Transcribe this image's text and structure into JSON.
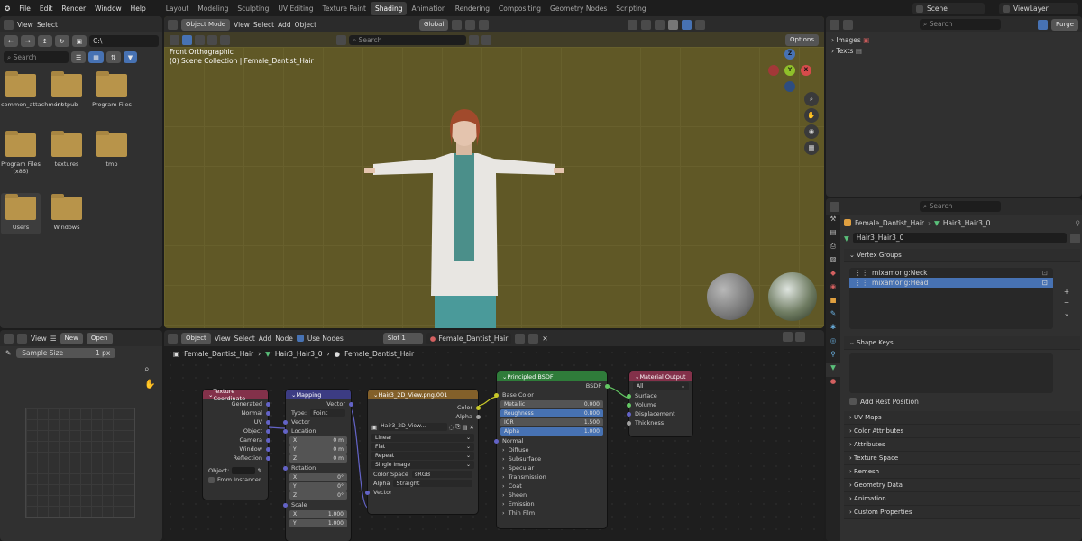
{
  "menubar": {
    "items": [
      "File",
      "Edit",
      "Render",
      "Window",
      "Help"
    ]
  },
  "workspaces": {
    "tabs": [
      "Layout",
      "Modeling",
      "Sculpting",
      "UV Editing",
      "Texture Paint",
      "Shading",
      "Animation",
      "Rendering",
      "Compositing",
      "Geometry Nodes",
      "Scripting"
    ],
    "active": "Shading"
  },
  "scene": {
    "name": "Scene",
    "view_layer": "ViewLayer"
  },
  "file_browser": {
    "menu": [
      "View",
      "Select"
    ],
    "path": "C:\\",
    "search_placeholder": "Search",
    "folders": [
      {
        "name": "common_attachment"
      },
      {
        "name": "inetpub"
      },
      {
        "name": "Program Files"
      },
      {
        "name": "Program Files (x86)"
      },
      {
        "name": "textures"
      },
      {
        "name": "tmp"
      },
      {
        "name": "Users"
      },
      {
        "name": "Windows"
      }
    ]
  },
  "viewport": {
    "mode": "Object Mode",
    "menus": [
      "View",
      "Select",
      "Add",
      "Object"
    ],
    "transform": "Global",
    "search_placeholder": "Search",
    "options_label": "Options",
    "view_name": "Front Orthographic",
    "collection": "(0) Scene Collection | Female_Dantist_Hair"
  },
  "outliner": {
    "search_placeholder": "Search",
    "purge_label": "Purge",
    "items": [
      "Images",
      "Texts"
    ]
  },
  "image_editor": {
    "view_label": "View",
    "new_label": "New",
    "open_label": "Open",
    "sample_size_label": "Sample Size",
    "sample_size_value": "1 px"
  },
  "node_editor": {
    "object_label": "Object",
    "menus": [
      "View",
      "Select",
      "Add",
      "Node"
    ],
    "use_nodes_label": "Use Nodes",
    "slot_label": "Slot 1",
    "material": "Female_Dantist_Hair",
    "breadcrumb": [
      "Female_Dantist_Hair",
      "Hair3_Hair3_0",
      "Female_Dantist_Hair"
    ]
  },
  "nodes": {
    "texcoord": {
      "title": "Texture Coordinate",
      "outputs": [
        "Generated",
        "Normal",
        "UV",
        "Object",
        "Camera",
        "Window",
        "Reflection"
      ],
      "object_label": "Object:",
      "from_instancer": "From Instancer"
    },
    "mapping": {
      "title": "Mapping",
      "output": "Vector",
      "type_label": "Type:",
      "type_value": "Point",
      "vector_label": "Vector",
      "location_label": "Location",
      "rotation_label": "Rotation",
      "scale_label": "Scale",
      "location": [
        {
          "axis": "X",
          "value": "0 m"
        },
        {
          "axis": "Y",
          "value": "0 m"
        },
        {
          "axis": "Z",
          "value": "0 m"
        }
      ],
      "rotation": [
        {
          "axis": "X",
          "value": "0°"
        },
        {
          "axis": "Y",
          "value": "0°"
        },
        {
          "axis": "Z",
          "value": "0°"
        }
      ],
      "scale": [
        {
          "axis": "X",
          "value": "1.000"
        },
        {
          "axis": "Y",
          "value": "1.000"
        }
      ]
    },
    "image": {
      "title": "Hair3_2D_View.png.001",
      "out_color": "Color",
      "out_alpha": "Alpha",
      "image_name": "Hair3_2D_View...",
      "interp": "Linear",
      "proj": "Flat",
      "ext": "Repeat",
      "source": "Single Image",
      "cs_label": "Color Space",
      "cs_value": "sRGB",
      "alpha_label": "Alpha",
      "alpha_value": "Straight",
      "vector": "Vector"
    },
    "bsdf": {
      "title": "Principled BSDF",
      "output": "BSDF",
      "base_color": "Base Color",
      "fields": [
        {
          "label": "Metallic",
          "value": "0.000"
        },
        {
          "label": "Roughness",
          "value": "0.800"
        },
        {
          "label": "IOR",
          "value": "1.500"
        },
        {
          "label": "Alpha",
          "value": "1.000"
        }
      ],
      "normal": "Normal",
      "subpanels": [
        "Diffuse",
        "Subsurface",
        "Specular",
        "Transmission",
        "Coat",
        "Sheen",
        "Emission",
        "Thin Film"
      ]
    },
    "output": {
      "title": "Material Output",
      "target": "All",
      "inputs": [
        "Surface",
        "Volume",
        "Displacement",
        "Thickness"
      ]
    }
  },
  "properties": {
    "search_placeholder": "Search",
    "object": "Female_Dantist_Hair",
    "mesh": "Hair3_Hair3_0",
    "mesh_field": "Hair3_Hair3_0",
    "vertex_groups_label": "Vertex Groups",
    "vertex_groups": [
      "mixamorig:Neck",
      "mixamorig:Head"
    ],
    "shape_keys_label": "Shape Keys",
    "add_rest_position": "Add Rest Position",
    "sections": [
      "UV Maps",
      "Color Attributes",
      "Attributes",
      "Texture Space",
      "Remesh",
      "Geometry Data",
      "Animation",
      "Custom Properties"
    ]
  },
  "colors": {
    "accent": "#4772b3",
    "viewport_bg": "#605826",
    "grid_line": "#6c6430"
  }
}
